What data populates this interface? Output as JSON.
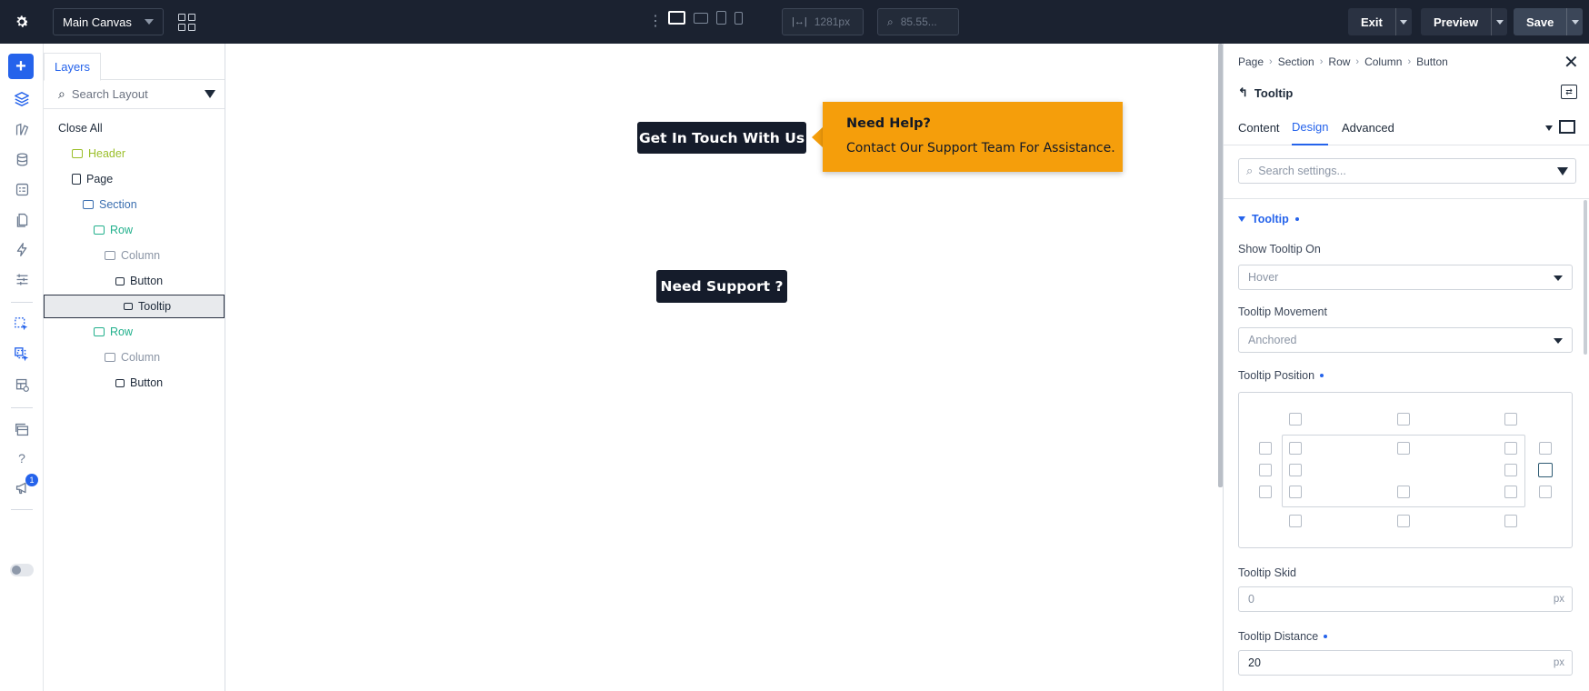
{
  "topbar": {
    "canvas_name": "Main Canvas",
    "width_value": "1281px",
    "zoom_value": "85.55...",
    "exit_label": "Exit",
    "preview_label": "Preview",
    "save_label": "Save"
  },
  "rail": {
    "notification_count": "1"
  },
  "layers": {
    "tab_label": "Layers",
    "search_placeholder": "Search Layout",
    "close_all_label": "Close All",
    "items": [
      {
        "label": "Header",
        "color": "#9bbf2a"
      },
      {
        "label": "Page",
        "color": "#1e2a3a"
      },
      {
        "label": "Section",
        "color": "#3b6fb0"
      },
      {
        "label": "Row",
        "color": "#22b08c"
      },
      {
        "label": "Column",
        "color": "#8b95a5"
      },
      {
        "label": "Button",
        "color": "#1e2a3a"
      },
      {
        "label": "Tooltip",
        "color": "#1e2a3a"
      },
      {
        "label": "Row",
        "color": "#22b08c"
      },
      {
        "label": "Column",
        "color": "#8b95a5"
      },
      {
        "label": "Button",
        "color": "#1e2a3a"
      }
    ]
  },
  "canvas": {
    "button_primary": "Get In Touch With Us",
    "tooltip_title": "Need Help?",
    "tooltip_text": "Contact Our Support Team For Assistance.",
    "button_secondary": "Need Support ?",
    "tooltip_color": "#f59e0b"
  },
  "settings": {
    "breadcrumbs": [
      "Page",
      "Section",
      "Row",
      "Column",
      "Button"
    ],
    "element_title": "Tooltip",
    "tabs": [
      "Content",
      "Design",
      "Advanced"
    ],
    "active_tab": "Design",
    "search_placeholder": "Search settings...",
    "group_title": "Tooltip",
    "show_on_label": "Show Tooltip On",
    "show_on_value": "Hover",
    "movement_label": "Tooltip Movement",
    "movement_value": "Anchored",
    "position_label": "Tooltip Position",
    "skid_label": "Tooltip Skid",
    "skid_value": "0",
    "skid_unit": "px",
    "distance_label": "Tooltip Distance",
    "distance_value": "20",
    "distance_unit": "px",
    "accent_color": "#2563eb"
  }
}
